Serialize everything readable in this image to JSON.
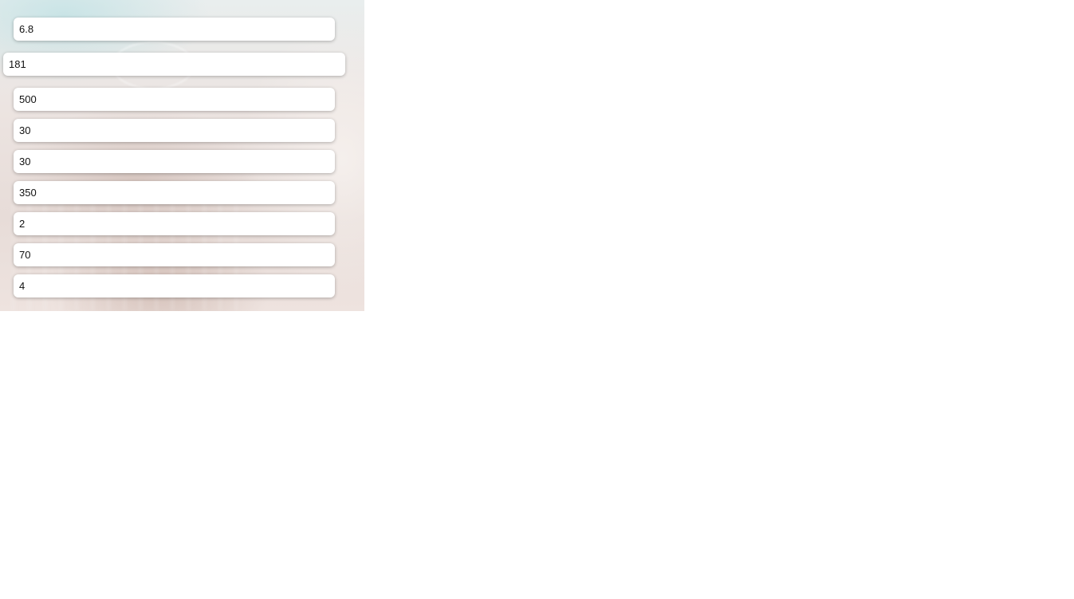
{
  "fields": {
    "f0": "6.8",
    "f1": "181",
    "f2": "500",
    "f3": "30",
    "f4": "30",
    "f5": "350",
    "f6": "2",
    "f7": "70",
    "f8": "4"
  }
}
